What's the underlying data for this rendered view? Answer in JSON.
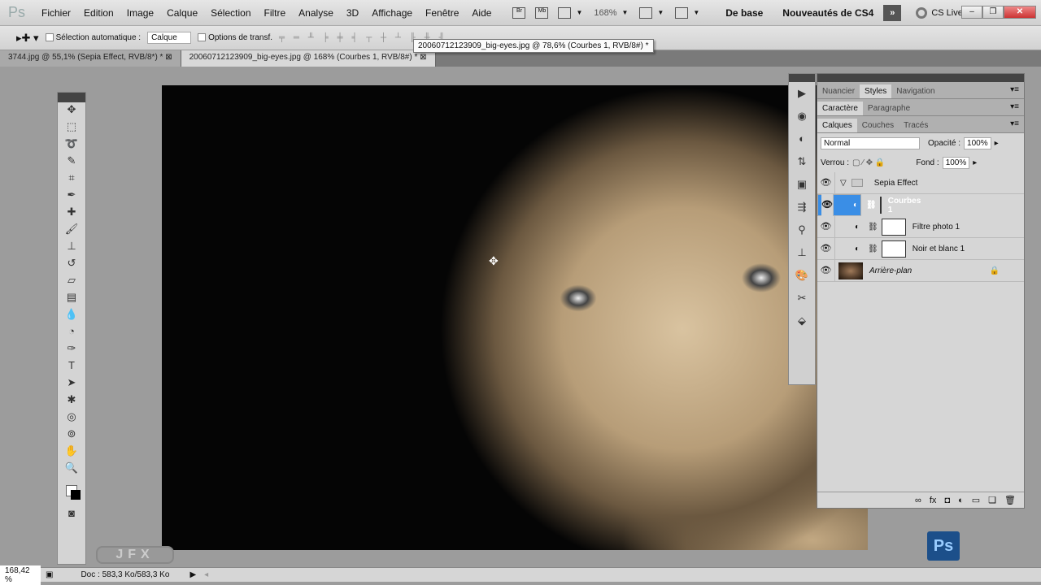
{
  "app": {
    "logo": "Ps"
  },
  "menu": [
    "Fichier",
    "Edition",
    "Image",
    "Calque",
    "Sélection",
    "Filtre",
    "Analyse",
    "3D",
    "Affichage",
    "Fenêtre",
    "Aide"
  ],
  "appbar": {
    "bridge": "Br",
    "minibridge": "Mb",
    "zoom": "168%",
    "workspace1": "De base",
    "workspace2": "Nouveautés de CS4",
    "cs_live": "CS Live"
  },
  "options": {
    "auto_select": "Sélection automatique :",
    "auto_select_value": "Calque",
    "transform": "Options de transf."
  },
  "tooltip": "20060712123909_big-eyes.jpg @ 78,6% (Courbes 1, RVB/8#) *",
  "tabs": [
    {
      "label": "3744.jpg @ 55,1% (Sepia Effect, RVB/8*) *"
    },
    {
      "label": "20060712123909_big-eyes.jpg @ 168% (Courbes 1, RVB/8#) *"
    }
  ],
  "panels": {
    "row1": [
      "Nuancier",
      "Styles",
      "Navigation"
    ],
    "row2": [
      "Caractère",
      "Paragraphe"
    ],
    "row3": [
      "Calques",
      "Couches",
      "Tracés"
    ],
    "blend_mode": "Normal",
    "opacity_label": "Opacité :",
    "opacity": "100%",
    "lock_label": "Verrou :",
    "fill_label": "Fond :",
    "fill": "100%",
    "layers": [
      {
        "name": "Sepia Effect",
        "type": "group"
      },
      {
        "name": "Courbes 1",
        "selected": true
      },
      {
        "name": "Filtre photo 1"
      },
      {
        "name": "Noir et blanc 1"
      },
      {
        "name": "Arrière-plan",
        "locked": true
      }
    ]
  },
  "status": {
    "zoom": "168,42 %",
    "doc": "Doc : 583,3 Ko/583,3 Ko"
  },
  "watermark": "JFX",
  "ps_badge": "Ps"
}
